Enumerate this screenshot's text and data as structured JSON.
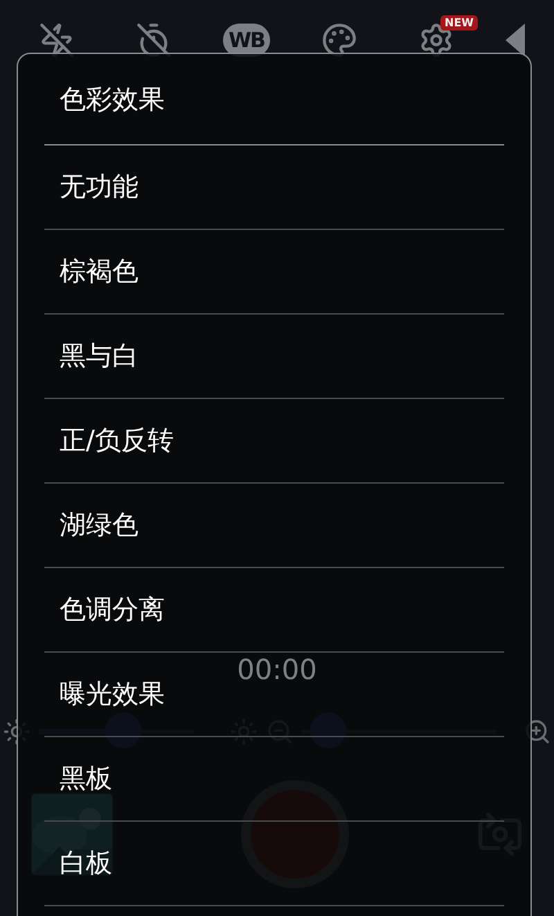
{
  "toolbar": {
    "white_balance": "WB",
    "settings_badge": "NEW"
  },
  "timer": "00:00",
  "dialog": {
    "title": "色彩效果",
    "options": [
      {
        "label": "无功能"
      },
      {
        "label": "棕褐色"
      },
      {
        "label": "黑与白"
      },
      {
        "label": "正/负反转"
      },
      {
        "label": "湖绿色"
      },
      {
        "label": "色调分离"
      },
      {
        "label": "曝光效果"
      },
      {
        "label": "黑板"
      },
      {
        "label": "白板"
      }
    ]
  }
}
